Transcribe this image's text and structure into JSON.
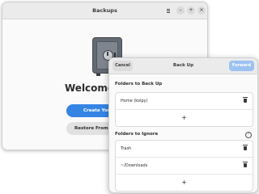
{
  "main_window": {
    "title": "Backups",
    "welcome_text": "Welcome to",
    "create_button": "Create Your Fi",
    "restore_button": "Restore From a Pr",
    "icons": [
      "menu-icon",
      "minimize-icon",
      "maximize-icon",
      "close-icon",
      "safe-icon"
    ]
  },
  "dialog": {
    "cancel_label": "Cancel",
    "title": "Back Up",
    "forward_label": "Forward",
    "backup_section": {
      "title": "Folders to Back Up",
      "items": [
        {
          "label": "Home (kolpy)"
        }
      ],
      "add_label": "+"
    },
    "ignore_section": {
      "title": "Folders to Ignore",
      "items": [
        {
          "label": "Trash"
        },
        {
          "label": "~/Downloads"
        }
      ],
      "add_label": "+"
    }
  },
  "colors": {
    "accent": "#3584e4",
    "forward_disabled": "#9cc2f1",
    "header_bg": "#ebebeb",
    "window_bg": "#fafafa"
  }
}
